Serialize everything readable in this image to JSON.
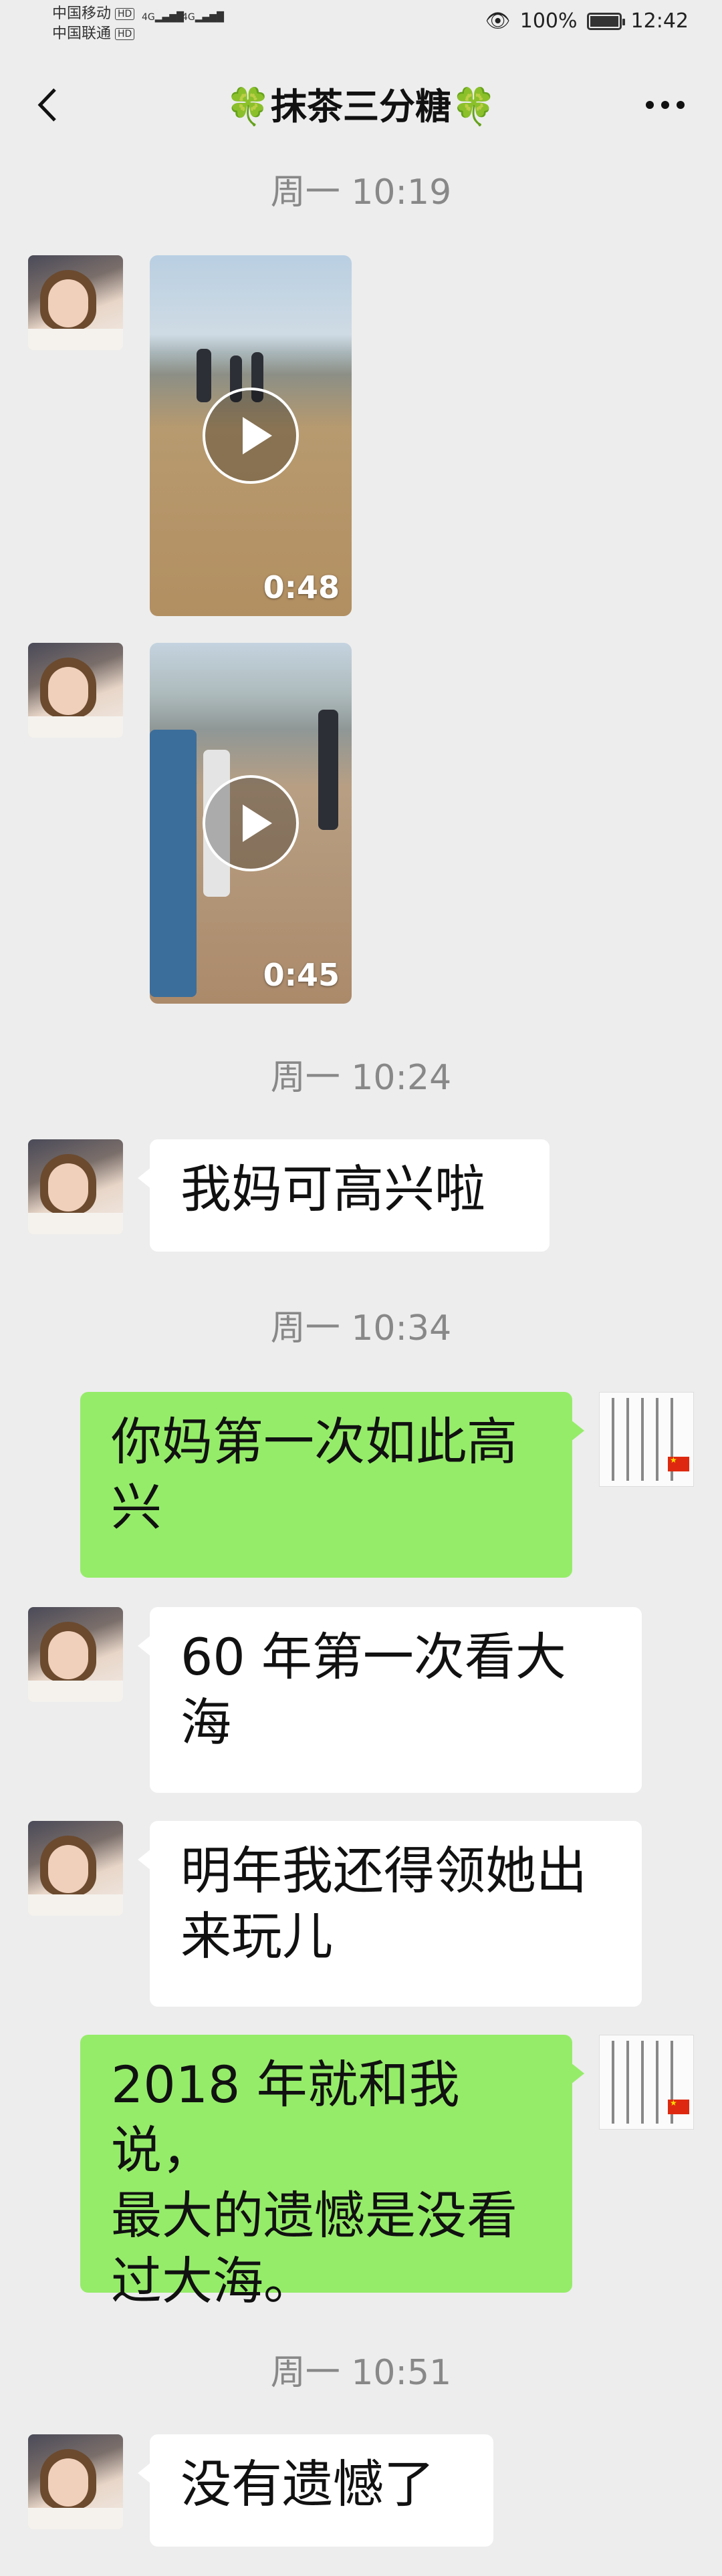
{
  "status_bar": {
    "carrier1": "中国移动",
    "carrier2": "中国联通",
    "hd": "HD",
    "net": "4G",
    "battery_text": "100%",
    "battery_level": 1.0,
    "time": "12:42"
  },
  "header": {
    "title": "抹茶三分糖",
    "title_decoration": "🍀"
  },
  "messages": {
    "t1": "周一 10:19",
    "video1_duration": "0:48",
    "video2_duration": "0:45",
    "t2": "周一 10:24",
    "m1": "我妈可高兴啦",
    "t3": "周一 10:34",
    "m2": "你妈第一次如此高\n兴",
    "m3": "60 年第一次看大\n海",
    "m4": "明年我还得领她出\n来玩儿",
    "m5": "2018 年就和我说，\n最大的遗憾是没看\n过大海。",
    "t4": "周一 10:51",
    "m6": "没有遗憾了"
  },
  "colors": {
    "background": "#ededed",
    "sent_bubble": "#95ec69",
    "received_bubble": "#ffffff",
    "timestamp": "#888888"
  }
}
